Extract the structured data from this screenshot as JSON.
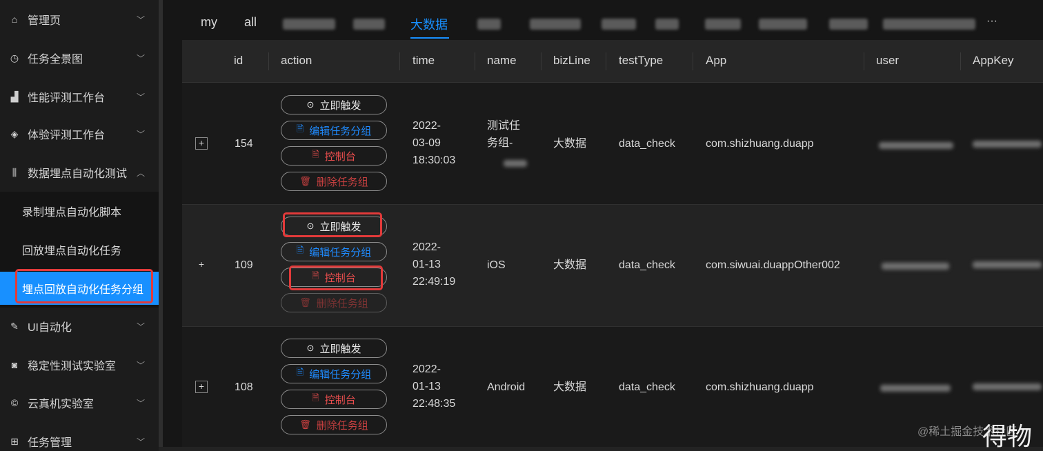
{
  "sidebar": {
    "items": [
      {
        "label": "管理页",
        "icon": "home-icon"
      },
      {
        "label": "任务全景图",
        "icon": "clock-icon"
      },
      {
        "label": "性能评测工作台",
        "icon": "chart-icon"
      },
      {
        "label": "体验评测工作台",
        "icon": "diamond-icon"
      },
      {
        "label": "数据埋点自动化测试",
        "icon": "signal-icon"
      },
      {
        "label": "UI自动化",
        "icon": "edit-icon"
      },
      {
        "label": "稳定性测试实验室",
        "icon": "camera-icon"
      },
      {
        "label": "云真机实验室",
        "icon": "copyright-icon"
      },
      {
        "label": "任务管理",
        "icon": "grid-icon"
      }
    ],
    "subitems": [
      {
        "label": "录制埋点自动化脚本"
      },
      {
        "label": "回放埋点自动化任务"
      },
      {
        "label": "埋点回放自动化任务分组"
      }
    ]
  },
  "tabs": [
    "my",
    "all",
    "大数据"
  ],
  "tabs_more": "···",
  "table": {
    "headers": [
      "id",
      "action",
      "time",
      "name",
      "bizLine",
      "testType",
      "App",
      "user",
      "AppKey"
    ],
    "actions": {
      "trigger": "立即触发",
      "edit": "编辑任务分组",
      "console": "控制台",
      "delete": "删除任务组"
    },
    "rows": [
      {
        "id": "154",
        "time": [
          "2022-",
          "03-09",
          "18:30:03"
        ],
        "name": [
          "测试任",
          "务组-"
        ],
        "bizLine": "大数据",
        "testType": "data_check",
        "app": "com.shizhuang.duapp"
      },
      {
        "id": "109",
        "time": [
          "2022-",
          "01-13",
          "22:49:19"
        ],
        "name": [
          "iOS"
        ],
        "bizLine": "大数据",
        "testType": "data_check",
        "app": "com.siwuai.duappOther002"
      },
      {
        "id": "108",
        "time": [
          "2022-",
          "01-13",
          "22:48:35"
        ],
        "name": [
          "Android"
        ],
        "bizLine": "大数据",
        "testType": "data_check",
        "app": "com.shizhuang.duapp"
      }
    ],
    "expand_symbol": "+"
  },
  "watermark": "@稀土掘金技术社区",
  "brand": "得物",
  "colors": {
    "accent": "#1890ff",
    "highlight": "#e23a3a",
    "edit": "#1f8bff",
    "console": "#e84d4d"
  }
}
